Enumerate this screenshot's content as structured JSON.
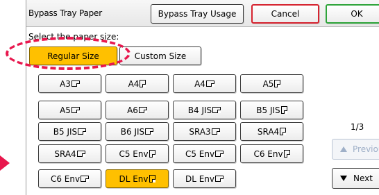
{
  "header": {
    "title": "Bypass Tray Paper",
    "usage_button": "Bypass Tray Usage",
    "cancel_button": "Cancel",
    "ok_button": "OK"
  },
  "prompt": "Select the paper size:",
  "size_tabs": {
    "regular": "Regular Size",
    "custom": "Custom Size",
    "selected": "Regular Size"
  },
  "paper_sizes": [
    [
      "A3",
      "A4",
      "A4",
      "A5"
    ],
    [
      "A5",
      "A6",
      "B4 JIS",
      "B5 JIS"
    ],
    [
      "B5 JIS",
      "B6 JIS",
      "SRA3",
      "SRA4"
    ],
    [
      "SRA4",
      "C5 Env",
      "C5 Env",
      "C6 Env"
    ],
    [
      "C6 Env",
      "DL Env",
      "DL Env"
    ]
  ],
  "selected_paper": "DL Env",
  "pagination": {
    "page": "1/3",
    "previous": "Previous",
    "next": "Next"
  },
  "colors": {
    "highlight": "#e8174d",
    "selected": "#ffc000",
    "cancel_border": "#d6232f",
    "ok_border": "#2ea43a"
  }
}
